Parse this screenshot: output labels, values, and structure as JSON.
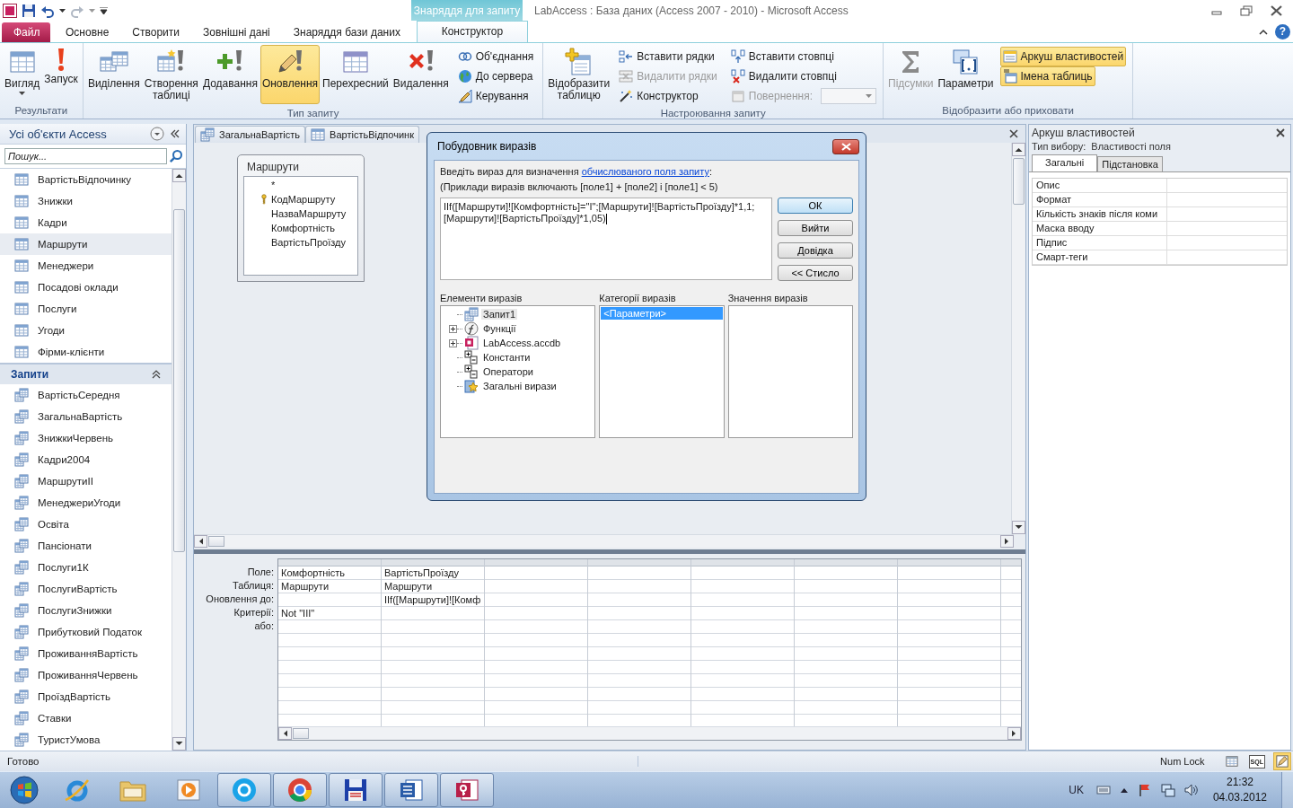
{
  "title_bar": {
    "title": "LabAccess : База даних (Access 2007 - 2010) - Microsoft Access",
    "context_label": "Знаряддя для запиту",
    "help": "?"
  },
  "ribbon_tabs": [
    {
      "label": "Файл",
      "kind": "file",
      "selected": false
    },
    {
      "label": "Основне",
      "kind": "tab",
      "selected": false
    },
    {
      "label": "Створити",
      "kind": "tab",
      "selected": false
    },
    {
      "label": "Зовнішні дані",
      "kind": "tab",
      "selected": false
    },
    {
      "label": "Знаряддя бази даних",
      "kind": "tab",
      "selected": false
    },
    {
      "label": "Конструктор",
      "kind": "context",
      "selected": true
    }
  ],
  "ribbon_groups": [
    {
      "label": "Результати",
      "columns": [
        {
          "kind": "large",
          "items": [
            {
              "label": "Вигляд",
              "selected": false,
              "disabled": false,
              "dropdown": true
            }
          ]
        },
        {
          "kind": "large",
          "items": [
            {
              "label": "Запуск",
              "selected": false,
              "disabled": false
            }
          ]
        }
      ]
    },
    {
      "label": "Тип запиту",
      "columns": [
        {
          "kind": "large",
          "items": [
            {
              "label": "Виділення",
              "selected": false,
              "disabled": false
            }
          ]
        },
        {
          "kind": "large",
          "items": [
            {
              "label": "Створення\nтаблиці",
              "selected": false,
              "disabled": false
            }
          ]
        },
        {
          "kind": "large",
          "items": [
            {
              "label": "Додавання",
              "selected": false,
              "disabled": false
            }
          ]
        },
        {
          "kind": "large",
          "items": [
            {
              "label": "Оновлення",
              "selected": true,
              "disabled": false
            }
          ]
        },
        {
          "kind": "large",
          "items": [
            {
              "label": "Перехресний",
              "selected": false,
              "disabled": false
            }
          ]
        },
        {
          "kind": "large",
          "items": [
            {
              "label": "Видалення",
              "selected": false,
              "disabled": false
            }
          ]
        },
        {
          "kind": "small",
          "items": [
            {
              "label": "Об'єднання",
              "selected": false,
              "disabled": false
            },
            {
              "label": "До сервера",
              "selected": false,
              "disabled": false
            },
            {
              "label": "Керування",
              "selected": false,
              "disabled": false
            }
          ]
        }
      ]
    },
    {
      "label": "Настроювання запиту",
      "columns": [
        {
          "kind": "large",
          "items": [
            {
              "label": "Відобразити\nтаблицю",
              "selected": false,
              "disabled": false
            }
          ]
        },
        {
          "kind": "small",
          "items": [
            {
              "label": "Вставити рядки",
              "selected": false,
              "disabled": false
            },
            {
              "label": "Видалити рядки",
              "selected": false,
              "disabled": true
            },
            {
              "label": "Конструктор",
              "selected": false,
              "disabled": false
            }
          ]
        },
        {
          "kind": "small",
          "items": [
            {
              "label": "Вставити стовпці",
              "selected": false,
              "disabled": false
            },
            {
              "label": "Видалити стовпці",
              "selected": false,
              "disabled": false
            },
            {
              "label": "Повернення:",
              "selected": false,
              "disabled": true,
              "combo": true
            }
          ]
        }
      ]
    },
    {
      "label": "Відобразити або приховати",
      "columns": [
        {
          "kind": "large",
          "items": [
            {
              "label": "Підсумки",
              "selected": false,
              "disabled": true
            }
          ]
        },
        {
          "kind": "large",
          "items": [
            {
              "label": "Параметри",
              "selected": false,
              "disabled": false
            }
          ]
        },
        {
          "kind": "small",
          "items": [
            {
              "label": "Аркуш властивостей",
              "selected": true,
              "disabled": false
            },
            {
              "label": "Імена таблиць",
              "selected": true,
              "disabled": false
            }
          ]
        }
      ]
    }
  ],
  "nav": {
    "title": "Усі об'єкти Access",
    "search_placeholder": "Пошук...",
    "tables": [
      {
        "label": "ВартістьВідпочинку",
        "selected": false
      },
      {
        "label": "Знижки",
        "selected": false
      },
      {
        "label": "Кадри",
        "selected": false
      },
      {
        "label": "Маршрути",
        "selected": true
      },
      {
        "label": "Менеджери",
        "selected": false
      },
      {
        "label": "Посадові оклади",
        "selected": false
      },
      {
        "label": "Послуги",
        "selected": false
      },
      {
        "label": "Угоди",
        "selected": false
      },
      {
        "label": "Фірми-клієнти",
        "selected": false
      }
    ],
    "queries": {
      "title": "Запити",
      "expanded": true,
      "items": [
        {
          "label": "ВартістьСередня",
          "selected": false
        },
        {
          "label": "ЗагальнаВартість",
          "selected": false
        },
        {
          "label": "ЗнижкиЧервень",
          "selected": false
        },
        {
          "label": "Кадри2004",
          "selected": false
        },
        {
          "label": "МаршрутиII",
          "selected": false
        },
        {
          "label": "МенеджериУгоди",
          "selected": false
        },
        {
          "label": "Освіта",
          "selected": false
        },
        {
          "label": "Пансіонати",
          "selected": false
        },
        {
          "label": "Послуги1К",
          "selected": false
        },
        {
          "label": "ПослугиВартість",
          "selected": false
        },
        {
          "label": "ПослугиЗнижки",
          "selected": false
        },
        {
          "label": "Прибутковий Податок",
          "selected": false
        },
        {
          "label": "ПроживанняВартість",
          "selected": false
        },
        {
          "label": "ПроживанняЧервень",
          "selected": false
        },
        {
          "label": "ПроїздВартість",
          "selected": false
        },
        {
          "label": "Ставки",
          "selected": false
        },
        {
          "label": "ТуристУмова",
          "selected": false
        }
      ]
    }
  },
  "document": {
    "tabs": [
      {
        "label": "ЗагальнаВартість",
        "kind": "query",
        "selected": false
      },
      {
        "label": "ВартістьВідпочинк",
        "kind": "table",
        "selected": false
      }
    ],
    "table_box": {
      "title": "Маршрути",
      "fields": [
        {
          "name": "*",
          "key": false
        },
        {
          "name": "КодМаршруту",
          "key": true
        },
        {
          "name": "НазваМаршруту",
          "key": false
        },
        {
          "name": "Комфортність",
          "key": false
        },
        {
          "name": "ВартістьПроїзду",
          "key": false
        }
      ]
    },
    "grid": {
      "rows": [
        {
          "label": "Поле:"
        },
        {
          "label": "Таблиця:"
        },
        {
          "label": "Оновлення до:"
        },
        {
          "label": "Критерії:"
        },
        {
          "label": "або:"
        }
      ],
      "columns": [
        {
          "field": "Комфортність",
          "table": "Маршрути",
          "criteria": "Not \"III\""
        },
        {
          "field": "ВартістьПроїзду",
          "table": "Маршрути",
          "update_to": "IIf([Маршрути]![Комф"
        }
      ]
    }
  },
  "dialog": {
    "title": "Побудовник виразів",
    "prompt": "Введіть вираз для визначення ",
    "prompt_link": "обчислюваного поля запиту",
    "prompt_end": ":",
    "example": "(Приклади виразів включають [поле1] + [поле2] і [поле1] < 5)",
    "expression": "IIf([Маршрути]![Комфортність]=\"I\";[Маршрути]![ВартістьПроїзду]*1,1;[Маршрути]![ВартістьПроїзду]*1,05)",
    "buttons": [
      {
        "label": "ОК",
        "default": true
      },
      {
        "label": "Вийти",
        "default": false
      },
      {
        "label": "Довідка",
        "default": false
      },
      {
        "label": "<< Стисло",
        "default": false
      }
    ],
    "elements": {
      "title": "Елементи виразів",
      "items": [
        {
          "label": "Запит1",
          "kind": "query",
          "selected": true
        },
        {
          "label": "Функції",
          "kind": "functions",
          "selected": false,
          "expanded": false
        },
        {
          "label": "LabAccess.accdb",
          "kind": "database",
          "selected": false,
          "expanded": false
        },
        {
          "label": "Константи",
          "kind": "node",
          "selected": false
        },
        {
          "label": "Оператори",
          "kind": "node",
          "selected": false
        },
        {
          "label": "Загальні вирази",
          "kind": "common",
          "selected": false
        }
      ]
    },
    "categories": {
      "title": "Категорії виразів",
      "items": [
        {
          "label": "<Параметри>",
          "selected": true
        }
      ]
    },
    "values": {
      "title": "Значення виразів"
    }
  },
  "property_sheet": {
    "title": "Аркуш властивостей",
    "selection_label": "Тип вибору:",
    "selection_type": "Властивості поля",
    "tabs": [
      {
        "label": "Загальні",
        "selected": true
      },
      {
        "label": "Підстановка",
        "selected": false
      }
    ],
    "properties": [
      {
        "name": "Опис"
      },
      {
        "name": "Формат"
      },
      {
        "name": "Кількість знаків після коми"
      },
      {
        "name": "Маска вводу"
      },
      {
        "name": "Підпис"
      },
      {
        "name": "Смарт-теги"
      }
    ]
  },
  "status_bar": {
    "text": "Готово",
    "num_lock": "Num Lock",
    "views": [
      {
        "kind": "datasheet",
        "selected": false
      },
      {
        "kind": "sql",
        "label": "SQL",
        "selected": false
      },
      {
        "kind": "design",
        "selected": true
      }
    ]
  },
  "taskbar": {
    "apps": [
      {
        "running": false
      },
      {
        "running": false
      },
      {
        "running": false
      },
      {
        "running": true
      },
      {
        "running": true
      },
      {
        "running": true
      },
      {
        "running": true
      },
      {
        "running": true
      }
    ],
    "language": "UK",
    "time": "21:32",
    "date": "04.03.2012"
  }
}
